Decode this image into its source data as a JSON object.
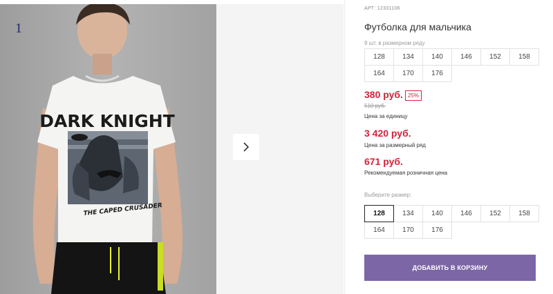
{
  "gallery": {
    "slide_number": "1",
    "print": {
      "headline": "DARK KNIGHT",
      "tagline": "THE CAPED CRUSADER"
    }
  },
  "product": {
    "article": "АРТ: 12331106",
    "title": "Футболка для мальчика",
    "row_note": "9 шт. в размерном ряду",
    "row_sizes": [
      "128",
      "134",
      "140",
      "146",
      "152",
      "158",
      "164",
      "170",
      "176"
    ],
    "price": "380 руб.",
    "discount": "25%",
    "old_price": "510 руб.",
    "unit_price_label": "Цена за единицу",
    "row_price": "3 420 руб.",
    "row_price_label": "Цена за размерный ряд",
    "retail_price": "671 руб.",
    "retail_price_label": "Рекомендуемая розничная цена",
    "choose_size_label": "Выберите размер:",
    "size_options": [
      "128",
      "134",
      "140",
      "146",
      "152",
      "158",
      "164",
      "170",
      "176"
    ],
    "selected_size": "128",
    "add_to_cart_label": "ДОБАВИТЬ В КОРЗИНУ"
  },
  "colors": {
    "price_red": "#d8203b",
    "button_purple": "#7c66a6"
  },
  "icons": {
    "next": "chevron-right-icon"
  }
}
